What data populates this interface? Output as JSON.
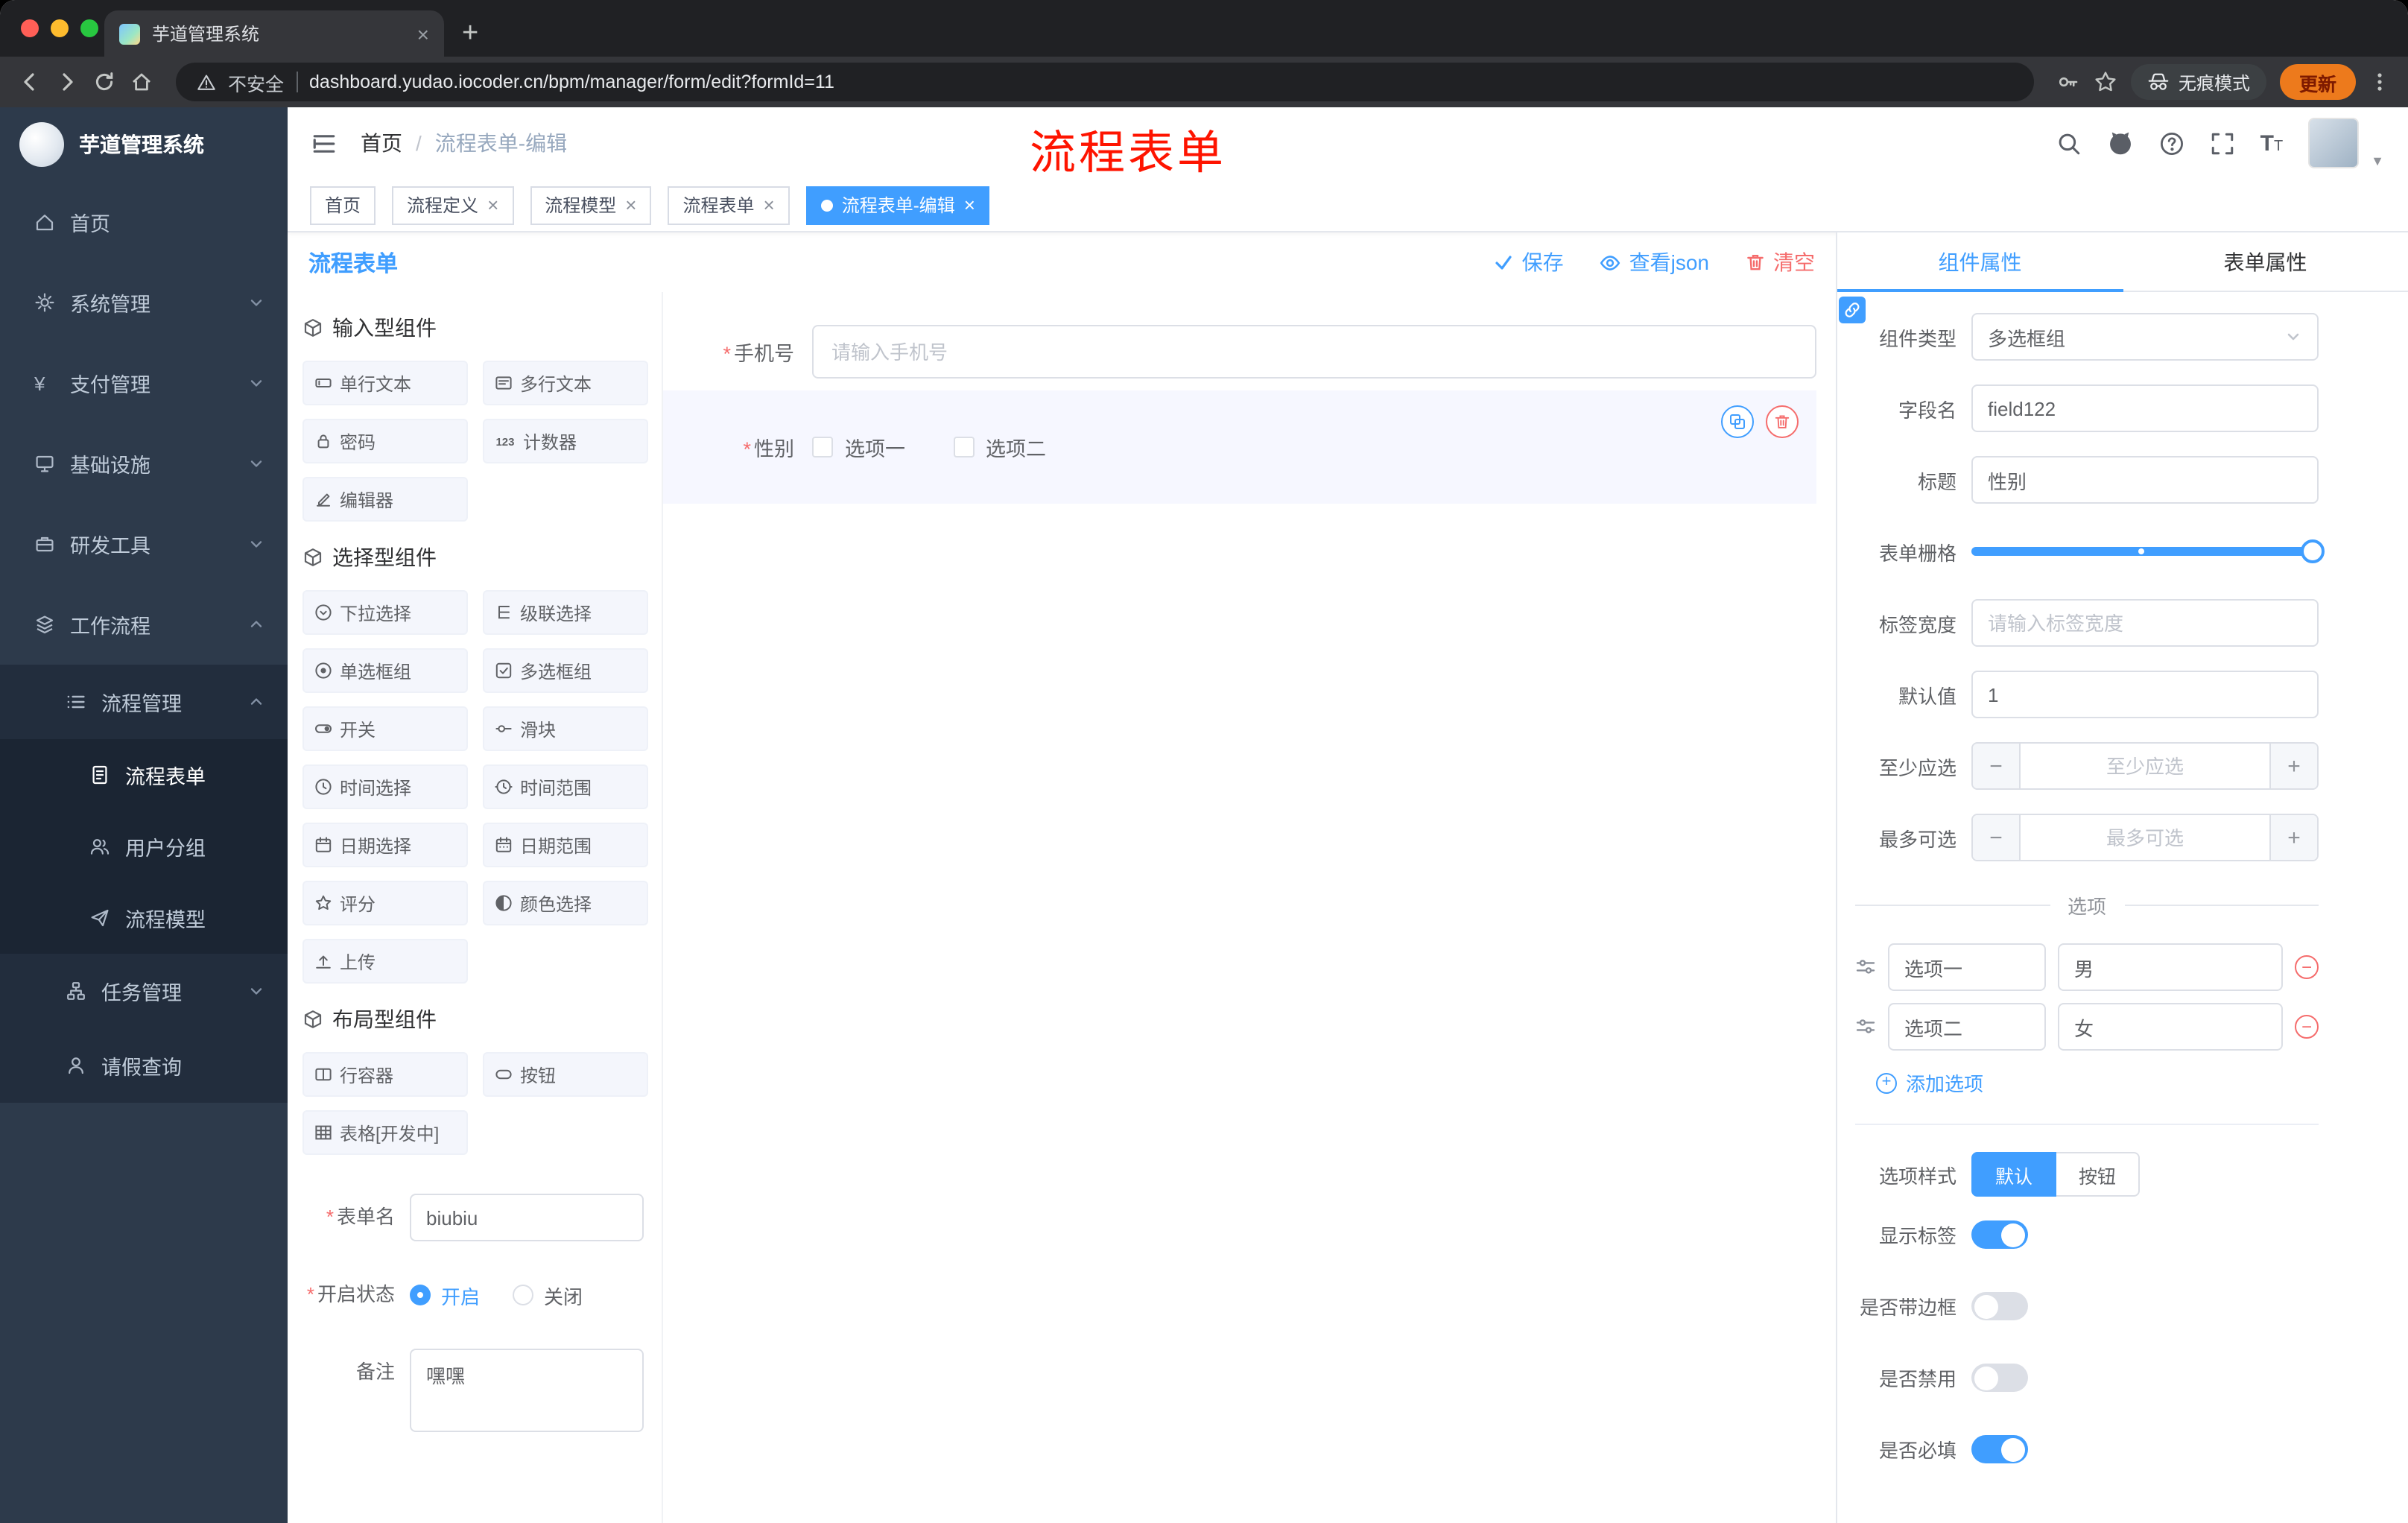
{
  "browser": {
    "tab_title": "芋道管理系统",
    "security_label": "不安全",
    "url": "dashboard.yudao.iocoder.cn/bpm/manager/form/edit?formId=11",
    "incognito_label": "无痕模式",
    "update_label": "更新"
  },
  "annotation": {
    "text": "流程表单",
    "color": "#fe1400"
  },
  "sidebar": {
    "logo_title": "芋道管理系统",
    "items": [
      {
        "label": "首页"
      },
      {
        "label": "系统管理"
      },
      {
        "label": "支付管理"
      },
      {
        "label": "基础设施"
      },
      {
        "label": "研发工具"
      },
      {
        "label": "工作流程"
      },
      {
        "label": "流程管理"
      },
      {
        "label": "流程表单",
        "active": true
      },
      {
        "label": "用户分组"
      },
      {
        "label": "流程模型"
      },
      {
        "label": "任务管理"
      },
      {
        "label": "请假查询"
      }
    ]
  },
  "breadcrumb": {
    "home": "首页",
    "current": "流程表单-编辑"
  },
  "tags": [
    {
      "label": "首页"
    },
    {
      "label": "流程定义"
    },
    {
      "label": "流程模型"
    },
    {
      "label": "流程表单"
    },
    {
      "label": "流程表单-编辑",
      "active": true
    }
  ],
  "designer": {
    "title": "流程表单",
    "actions": {
      "save": "保存",
      "view_json": "查看json",
      "clear": "清空"
    },
    "palette": {
      "sections": [
        {
          "title": "输入型组件",
          "items": [
            "单行文本",
            "多行文本",
            "密码",
            "计数器",
            "编辑器"
          ]
        },
        {
          "title": "选择型组件",
          "items": [
            "下拉选择",
            "级联选择",
            "单选框组",
            "多选框组",
            "开关",
            "滑块",
            "时间选择",
            "时间范围",
            "日期选择",
            "日期范围",
            "评分",
            "颜色选择",
            "上传"
          ]
        },
        {
          "title": "布局型组件",
          "items": [
            "行容器",
            "按钮",
            "表格[开发中]"
          ]
        }
      ]
    },
    "form_meta": {
      "name_label": "表单名",
      "name_value": "biubiu",
      "status_label": "开启状态",
      "status_on": "开启",
      "status_off": "关闭",
      "status_selected": "开启",
      "remark_label": "备注",
      "remark_value": "嘿嘿"
    },
    "canvas": {
      "fields": [
        {
          "label": "手机号",
          "required": true,
          "type": "input",
          "placeholder": "请输入手机号"
        },
        {
          "label": "性别",
          "required": true,
          "type": "checkbox-group",
          "selected": true,
          "options": [
            "选项一",
            "选项二"
          ]
        }
      ]
    }
  },
  "properties": {
    "tabs": [
      "组件属性",
      "表单属性"
    ],
    "active_tab": "组件属性",
    "fields": {
      "component_type_label": "组件类型",
      "component_type_value": "多选框组",
      "name_label": "字段名",
      "name_value": "field122",
      "title_label": "标题",
      "title_value": "性别",
      "grid_label": "表单栅格",
      "width_label": "标签宽度",
      "width_placeholder": "请输入标签宽度",
      "default_label": "默认值",
      "default_value": "1",
      "min_label": "至少应选",
      "min_placeholder": "至少应选",
      "max_label": "最多可选",
      "max_placeholder": "最多可选"
    },
    "options_section": {
      "title": "选项",
      "add_label": "添加选项",
      "options": [
        {
          "label": "选项一",
          "value": "男"
        },
        {
          "label": "选项二",
          "value": "女"
        }
      ]
    },
    "style_section": {
      "label": "选项样式",
      "options": [
        "默认",
        "按钮"
      ],
      "selected": "默认"
    },
    "toggles": [
      {
        "label": "显示标签",
        "on": true
      },
      {
        "label": "是否带边框",
        "on": false
      },
      {
        "label": "是否禁用",
        "on": false
      },
      {
        "label": "是否必填",
        "on": true
      }
    ]
  },
  "colors": {
    "primary": "#409eff",
    "danger": "#f56c6c",
    "sidebar_bg": "#2d3a4b"
  }
}
